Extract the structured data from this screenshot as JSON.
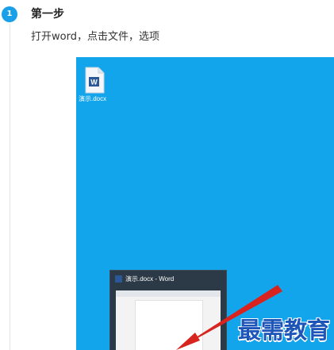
{
  "step": {
    "number": "1",
    "title": "第一步",
    "description": "打开word，点击文件，选项"
  },
  "screenshot": {
    "desktop_icon": {
      "icon": "word-document-icon",
      "label": "演示.docx"
    },
    "taskbar_preview": {
      "title": "演示.docx - Word",
      "icon": "word-app-icon"
    },
    "background_color": "#12a5ec",
    "arrow_color": "#d9231e"
  },
  "watermark": "最需教育"
}
